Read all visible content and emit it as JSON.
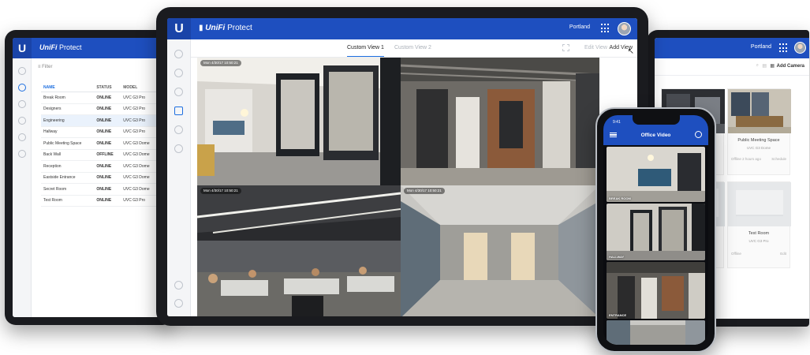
{
  "app": {
    "brand_letter": "U",
    "brand_name": "UniFi",
    "product": "Protect",
    "location": "Portland",
    "accent": "#1e4fbf",
    "online_color": "#29b36b"
  },
  "left_tablet": {
    "filter_label": "Filter",
    "columns": [
      "NAME",
      "STATUS",
      "MODEL"
    ],
    "rows": [
      {
        "name": "Break Room",
        "status": "ONLINE",
        "model": "UVC G3 Pro"
      },
      {
        "name": "Designers",
        "status": "ONLINE",
        "model": "UVC G3 Pro"
      },
      {
        "name": "Engineering",
        "status": "ONLINE",
        "model": "UVC G3 Pro"
      },
      {
        "name": "Hallway",
        "status": "ONLINE",
        "model": "UVC G3 Pro"
      },
      {
        "name": "Public Meeting Space",
        "status": "ONLINE",
        "model": "UVC G3 Dome"
      },
      {
        "name": "Back Wall",
        "status": "OFFLINE",
        "model": "UVC G3 Dome"
      },
      {
        "name": "Reception",
        "status": "ONLINE",
        "model": "UVC G3 Dome"
      },
      {
        "name": "Eastside Entrance",
        "status": "ONLINE",
        "model": "UVC G3 Dome"
      },
      {
        "name": "Secret Room",
        "status": "ONLINE",
        "model": "UVC G3 Dome"
      },
      {
        "name": "Test Room",
        "status": "ONLINE",
        "model": "UVC G3 Pro"
      }
    ]
  },
  "main_tablet": {
    "tabs": [
      "Custom View 1",
      "Custom View 2"
    ],
    "actions": [
      "Edit View",
      "Add View"
    ],
    "cameras": [
      {
        "timestamp": "Mon 4/30/17 10:50:21"
      },
      {
        "timestamp": "Mon 4/30/17 10:50:21"
      },
      {
        "timestamp": "Mon 4/30/17 10:50:21"
      },
      {
        "timestamp": "Mon 4/30/17 10:50:21"
      }
    ]
  },
  "right_tablet": {
    "add_camera": "Add Camera",
    "cards": [
      {
        "name": "Public Meeting Space",
        "sub": "UVC G3 Dome",
        "meta_left": "Offline 2 hours ago",
        "meta_right": "Schedule"
      },
      {
        "name": "Test Room",
        "sub": "UVC G3 Pro",
        "meta_left": "Offline",
        "meta_right": "Edit"
      }
    ]
  },
  "phone": {
    "time": "9:41",
    "title": "Office Video",
    "cameras": [
      {
        "label": "BREAK ROOM"
      },
      {
        "label": "HALLWAY"
      },
      {
        "label": "ENTRANCE"
      },
      {
        "label": ""
      }
    ]
  }
}
